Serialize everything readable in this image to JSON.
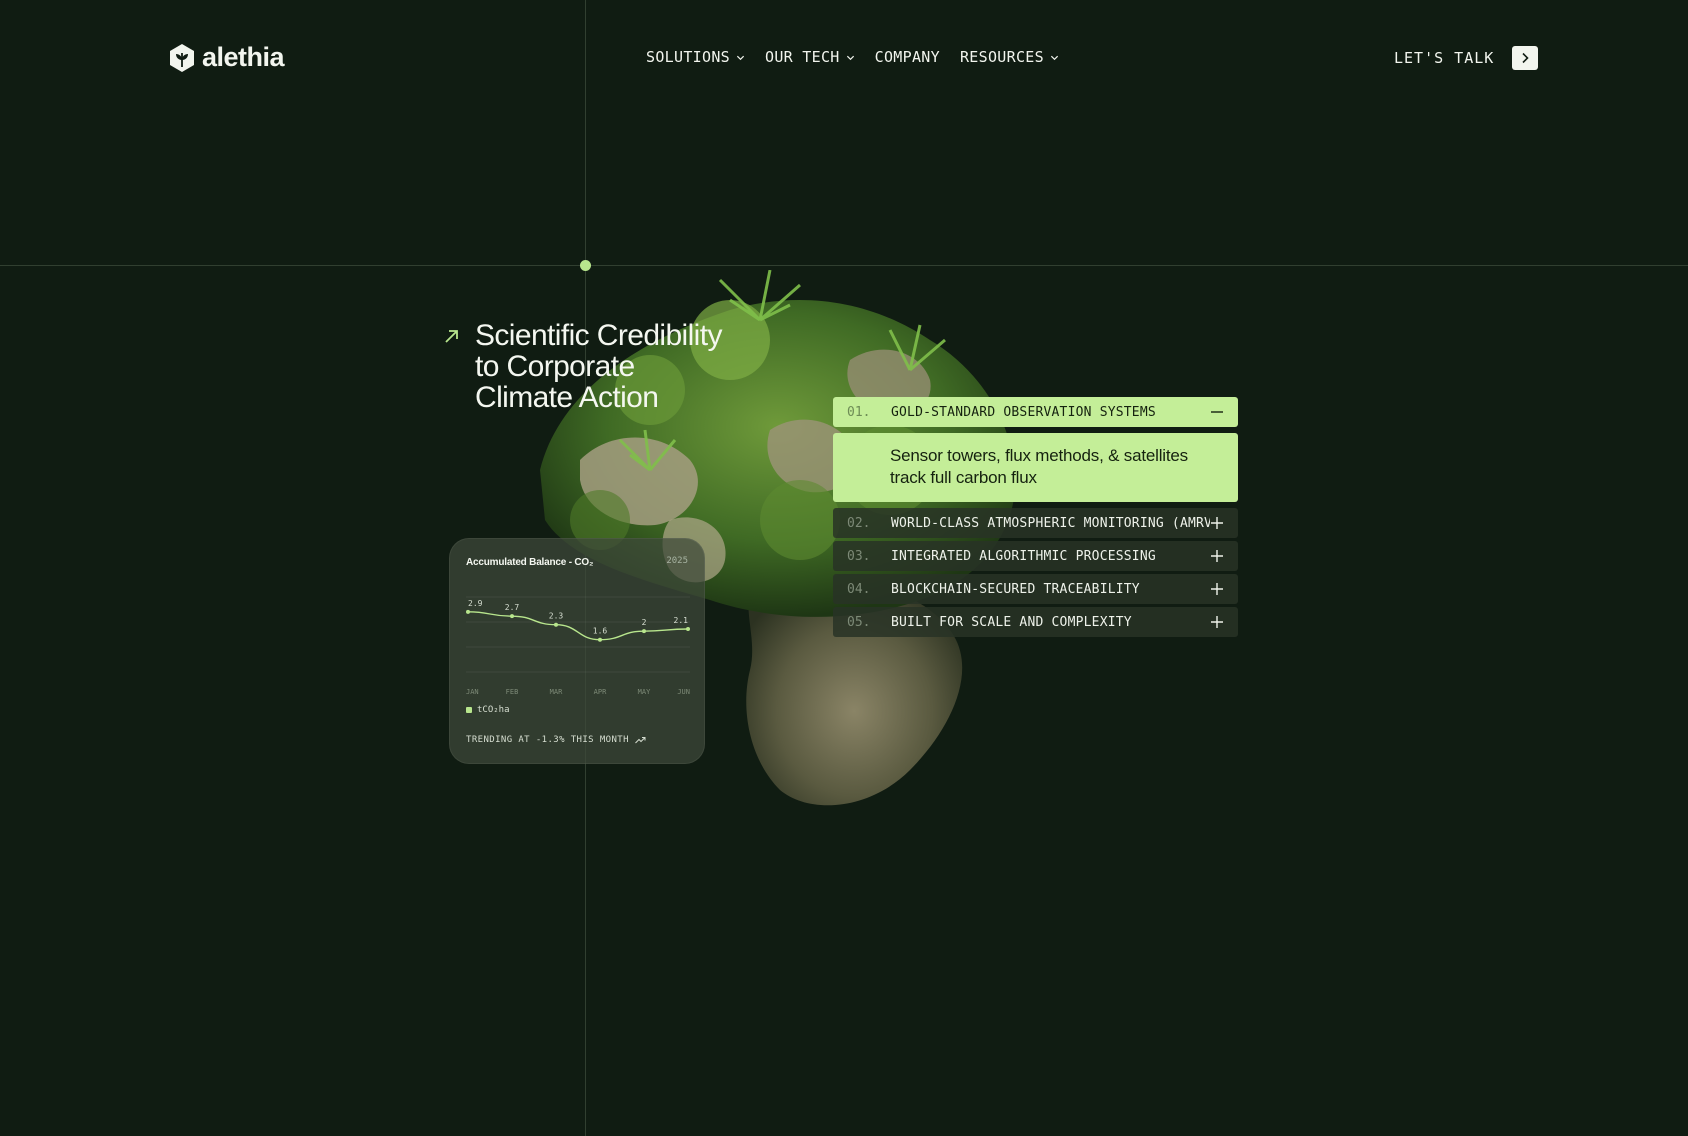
{
  "brand": {
    "name": "alethia"
  },
  "nav": [
    {
      "label": "SOLUTIONS",
      "has_dropdown": true
    },
    {
      "label": "OUR TECH",
      "has_dropdown": true
    },
    {
      "label": "COMPANY",
      "has_dropdown": false
    },
    {
      "label": "RESOURCES",
      "has_dropdown": true
    }
  ],
  "cta": {
    "label": "LET'S TALK",
    "icon": "chevron-right-icon"
  },
  "hero": {
    "title_lines": [
      "Scientific Credibility",
      "to Corporate",
      "Climate Action"
    ],
    "icon": "arrow-up-right-icon"
  },
  "chart_data": {
    "type": "line",
    "title": "Accumulated Balance - CO₂",
    "year": "2025",
    "categories": [
      "JAN",
      "FEB",
      "MAR",
      "APR",
      "MAY",
      "JUN"
    ],
    "series": [
      {
        "name": "tCO₂ha",
        "values": [
          2.9,
          2.7,
          2.3,
          1.6,
          2,
          2.1
        ],
        "labels": [
          "2.9",
          "2.7",
          "2.3",
          "1.6",
          "2",
          "2.1"
        ]
      }
    ],
    "ylim": [
      0,
      3.5
    ],
    "legend_position": "bottom-left",
    "trend_text": "TRENDING AT -1.3% THIS MONTH",
    "color": "#b8e68d"
  },
  "accordion": [
    {
      "num": "01.",
      "label": "GOLD-STANDARD OBSERVATION SYSTEMS",
      "open": true,
      "body": "Sensor towers, flux methods, & satellites track full carbon flux"
    },
    {
      "num": "02.",
      "label": "WORLD-CLASS ATMOSPHERIC MONITORING (AMRV)",
      "open": false
    },
    {
      "num": "03.",
      "label": "INTEGRATED ALGORITHMIC PROCESSING",
      "open": false
    },
    {
      "num": "04.",
      "label": "BLOCKCHAIN-SECURED TRACEABILITY",
      "open": false
    },
    {
      "num": "05.",
      "label": "BUILT FOR SCALE AND COMPLEXITY",
      "open": false
    }
  ],
  "colors": {
    "background": "#101c12",
    "accent": "#c4ee98",
    "dot": "#b8e68d"
  }
}
